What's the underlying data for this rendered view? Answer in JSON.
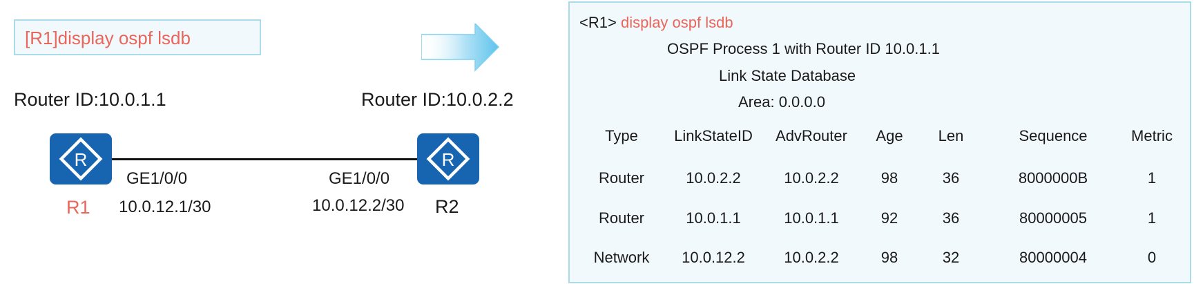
{
  "command_box": {
    "text": "[R1]display ospf lsdb"
  },
  "topology": {
    "r1": {
      "router_id": "Router ID:10.0.1.1",
      "name": "R1",
      "interface": "GE1/0/0",
      "ip": "10.0.12.1/30"
    },
    "r2": {
      "router_id": "Router ID:10.0.2.2",
      "name": "R2",
      "interface": "GE1/0/0",
      "ip": "10.0.12.2/30"
    },
    "router_glyph": "R",
    "colors": {
      "router_fill": "#1764b0",
      "r1_label": "#e9665b",
      "r2_label": "#1a1a1a",
      "accent": "#e9665b",
      "panel_border": "#a9dbe9",
      "panel_bg": "#f2f9fd"
    }
  },
  "output": {
    "prompt": "<R1>",
    "command": "display ospf lsdb",
    "process_line": "OSPF Process 1 with Router ID 10.0.1.1",
    "db_title": "Link State Database",
    "area_line": "Area: 0.0.0.0",
    "columns": [
      "Type",
      "LinkStateID",
      "AdvRouter",
      "Age",
      "Len",
      "Sequence",
      "Metric"
    ],
    "rows": [
      [
        "Router",
        "10.0.2.2",
        "10.0.2.2",
        "98",
        "36",
        "8000000B",
        "1"
      ],
      [
        "Router",
        "10.0.1.1",
        "10.0.1.1",
        "92",
        "36",
        "80000005",
        "1"
      ],
      [
        "Network",
        "10.0.12.2",
        "10.0.2.2",
        "98",
        "32",
        "80000004",
        "0"
      ]
    ]
  }
}
